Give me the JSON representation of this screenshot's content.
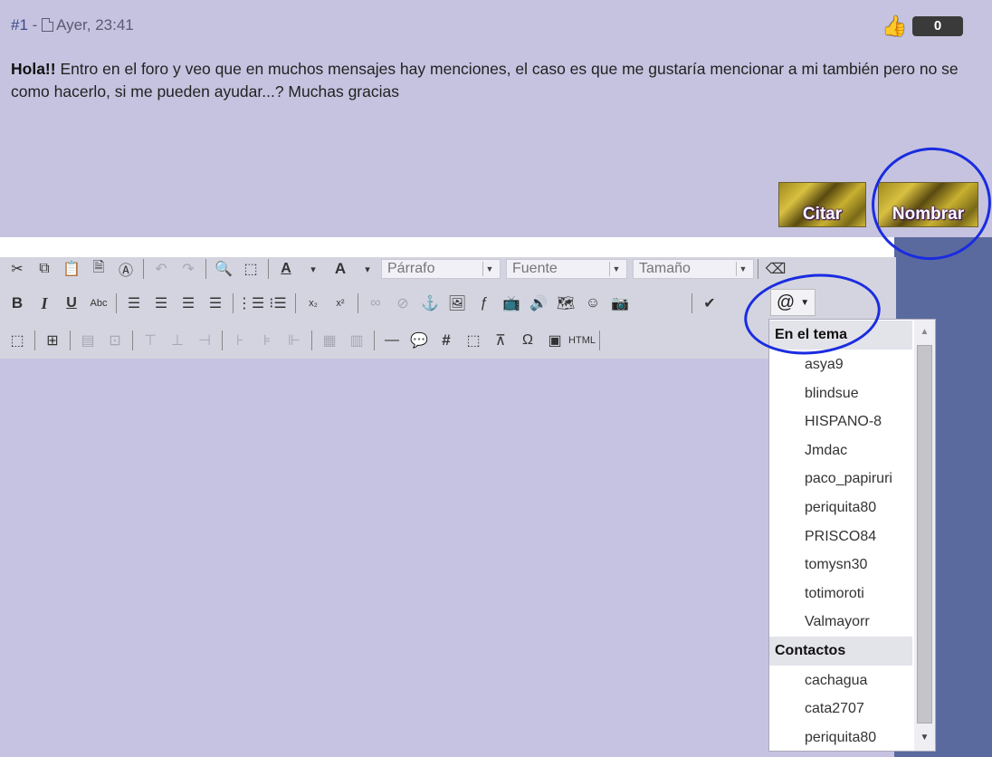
{
  "post": {
    "number": "#1",
    "separator": "-",
    "date": "Ayer, 23:41",
    "like_count": "0",
    "body_strong": "Hola!!",
    "body_text": " Entro en el foro y veo que en muchos mensajes hay menciones, el caso es que me gustaría mencionar a mi también pero no se como hacerlo, si me pueden ayudar...? Muchas gracias",
    "quote_button": "Citar",
    "mention_button": "Nombrar"
  },
  "icons": {
    "document": "document-icon",
    "like": "thumbs-up-icon",
    "at": "at-sign-icon"
  },
  "toolbar": {
    "format_select": "Párrafo",
    "font_select": "Fuente",
    "size_select": "Tamaño",
    "strike_label": "Abc",
    "html_label": "HTML",
    "at_symbol": "@"
  },
  "mention_dropdown": {
    "section_topic": "En el tema",
    "topic_users": [
      "asya9",
      "blindsue",
      "HISPANO-8",
      "Jmdac",
      "paco_papiruri",
      "periquita80",
      "PRISCO84",
      "tomysn30",
      "totimoroti",
      "Valmayorr"
    ],
    "section_contacts": "Contactos",
    "contacts": [
      "cachagua",
      "cata2707",
      "periquita80"
    ]
  },
  "colors": {
    "post_bg": "#c6c3e0",
    "right_panel": "#5b6a9e",
    "annotation_circle": "#1a2ce0"
  }
}
